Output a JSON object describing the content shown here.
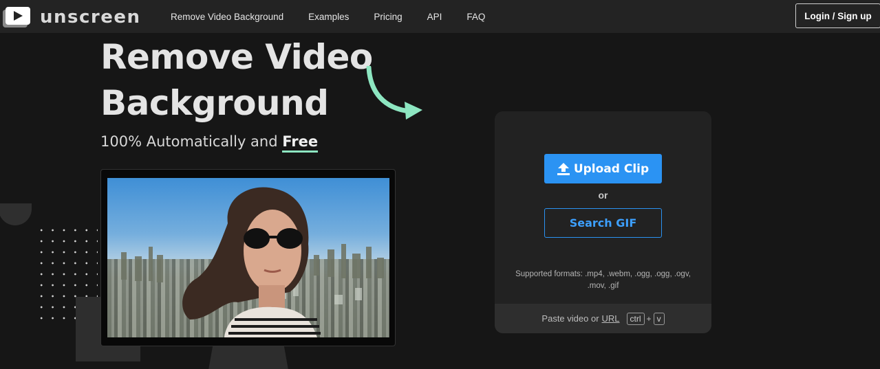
{
  "brand": {
    "name": "unscreen",
    "icon": "play-icon"
  },
  "nav": {
    "links": [
      "Remove Video Background",
      "Examples",
      "Pricing",
      "API",
      "FAQ"
    ],
    "login": "Login / Sign up"
  },
  "hero": {
    "title_line1": "Remove Video",
    "title_line2": "Background",
    "subtitle_prefix": "100% Automatically and ",
    "subtitle_emph": "Free"
  },
  "upload": {
    "upload_label": "Upload Clip",
    "or_label": "or",
    "search_label": "Search GIF",
    "formats": "Supported formats: .mp4, .webm, .ogg, .ogg, .ogv, .mov, .gif",
    "paste_prefix": "Paste video or",
    "paste_link": "URL",
    "key1": "ctrl",
    "key_plus": "+",
    "key2": "v"
  },
  "colors": {
    "accent": "#2b93f3",
    "highlight": "#8de6c1",
    "background": "#161616"
  }
}
